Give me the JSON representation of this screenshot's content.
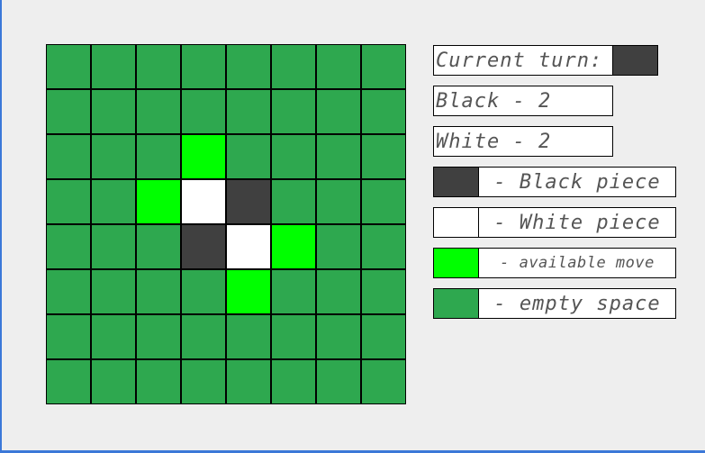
{
  "colors": {
    "background": "#eeeeee",
    "empty": "#2ea84f",
    "available": "#00ff00",
    "black": "#404040",
    "white": "#ffffff"
  },
  "status": {
    "turn_label": "Current turn:",
    "turn_color": "black",
    "black_score": "Black - 2",
    "white_score": "White - 2"
  },
  "legend": [
    {
      "swatch": "black",
      "label": "- Black piece"
    },
    {
      "swatch": "white",
      "label": "- White piece"
    },
    {
      "swatch": "available",
      "label": "- available move"
    },
    {
      "swatch": "empty",
      "label": "- empty space"
    }
  ],
  "board": [
    [
      "empty",
      "empty",
      "empty",
      "empty",
      "empty",
      "empty",
      "empty",
      "empty"
    ],
    [
      "empty",
      "empty",
      "empty",
      "empty",
      "empty",
      "empty",
      "empty",
      "empty"
    ],
    [
      "empty",
      "empty",
      "empty",
      "available",
      "empty",
      "empty",
      "empty",
      "empty"
    ],
    [
      "empty",
      "empty",
      "available",
      "white",
      "black",
      "empty",
      "empty",
      "empty"
    ],
    [
      "empty",
      "empty",
      "empty",
      "black",
      "white",
      "available",
      "empty",
      "empty"
    ],
    [
      "empty",
      "empty",
      "empty",
      "empty",
      "available",
      "empty",
      "empty",
      "empty"
    ],
    [
      "empty",
      "empty",
      "empty",
      "empty",
      "empty",
      "empty",
      "empty",
      "empty"
    ],
    [
      "empty",
      "empty",
      "empty",
      "empty",
      "empty",
      "empty",
      "empty",
      "empty"
    ]
  ]
}
